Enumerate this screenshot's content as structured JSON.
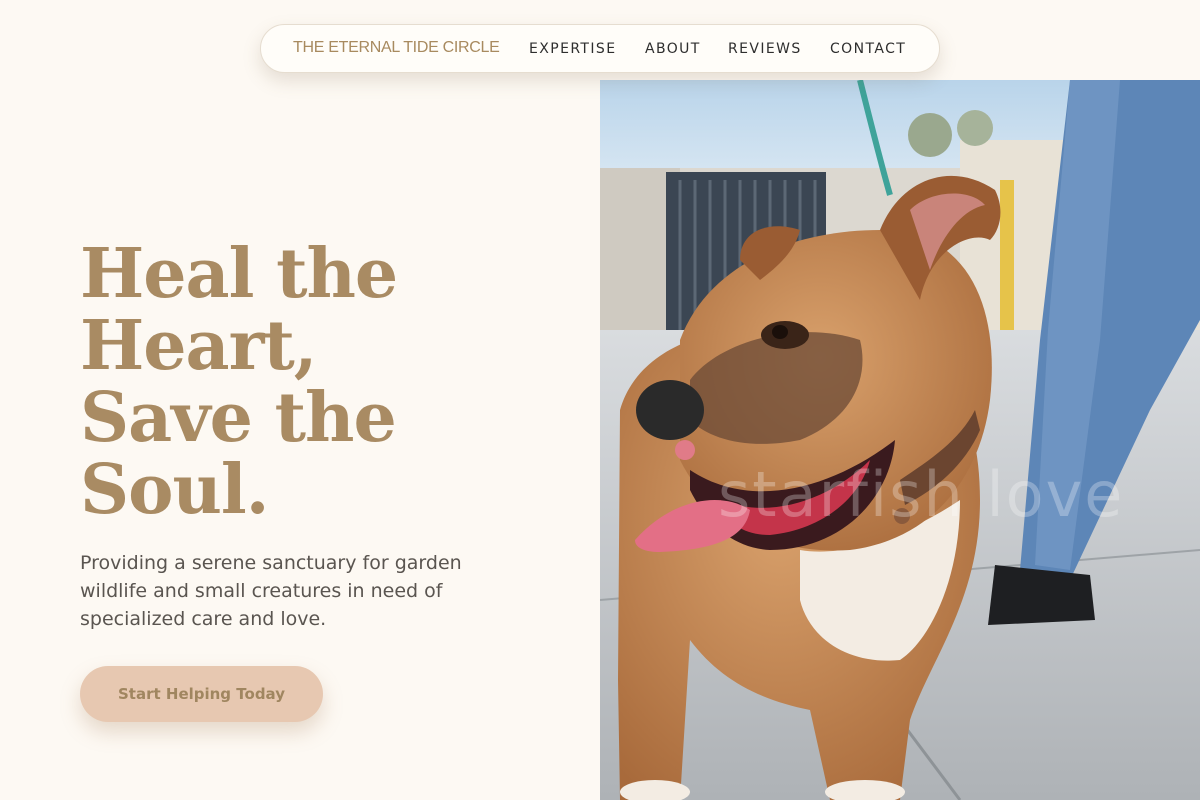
{
  "nav": {
    "brand": "THE ETERNAL TIDE CIRCLE",
    "links": [
      "EXPERTISE",
      "ABOUT",
      "REVIEWS",
      "CONTACT"
    ]
  },
  "hero": {
    "title_lines": [
      "Heal the",
      "Heart,",
      "Save the",
      "Soul."
    ],
    "subtitle": "Providing a serene sanctuary for garden wildlife and small creatures in need of specialized care and love.",
    "cta": "Start Helping Today"
  },
  "photo": {
    "subject": "dog-on-leash",
    "watermark": "starfish love"
  },
  "colors": {
    "background": "#fdf9f3",
    "accent": "#a98b63",
    "button": "#e7c8b1"
  }
}
